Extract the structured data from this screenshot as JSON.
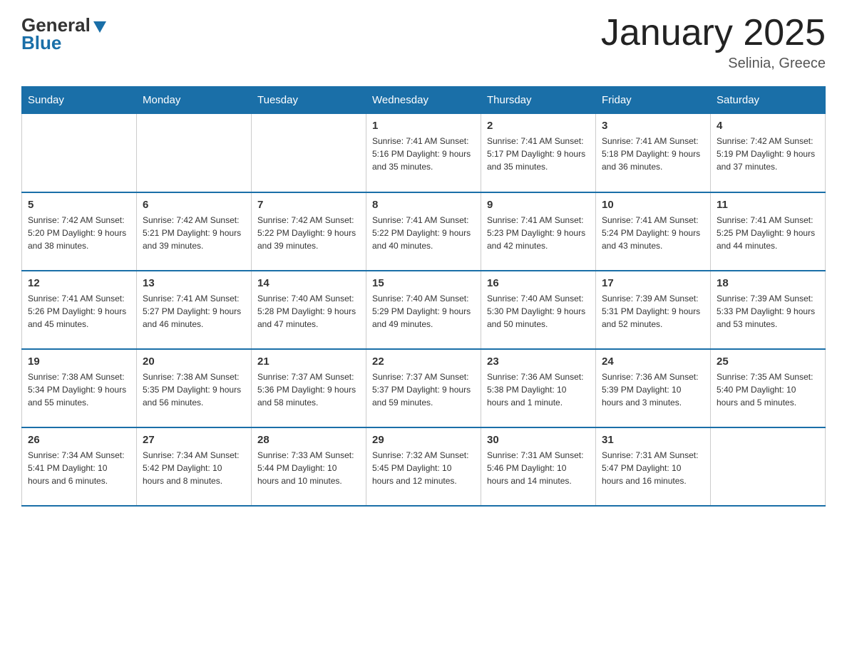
{
  "logo": {
    "general": "General",
    "blue": "Blue"
  },
  "header": {
    "title": "January 2025",
    "location": "Selinia, Greece"
  },
  "weekdays": [
    "Sunday",
    "Monday",
    "Tuesday",
    "Wednesday",
    "Thursday",
    "Friday",
    "Saturday"
  ],
  "weeks": [
    [
      {
        "day": "",
        "info": ""
      },
      {
        "day": "",
        "info": ""
      },
      {
        "day": "",
        "info": ""
      },
      {
        "day": "1",
        "info": "Sunrise: 7:41 AM\nSunset: 5:16 PM\nDaylight: 9 hours\nand 35 minutes."
      },
      {
        "day": "2",
        "info": "Sunrise: 7:41 AM\nSunset: 5:17 PM\nDaylight: 9 hours\nand 35 minutes."
      },
      {
        "day": "3",
        "info": "Sunrise: 7:41 AM\nSunset: 5:18 PM\nDaylight: 9 hours\nand 36 minutes."
      },
      {
        "day": "4",
        "info": "Sunrise: 7:42 AM\nSunset: 5:19 PM\nDaylight: 9 hours\nand 37 minutes."
      }
    ],
    [
      {
        "day": "5",
        "info": "Sunrise: 7:42 AM\nSunset: 5:20 PM\nDaylight: 9 hours\nand 38 minutes."
      },
      {
        "day": "6",
        "info": "Sunrise: 7:42 AM\nSunset: 5:21 PM\nDaylight: 9 hours\nand 39 minutes."
      },
      {
        "day": "7",
        "info": "Sunrise: 7:42 AM\nSunset: 5:22 PM\nDaylight: 9 hours\nand 39 minutes."
      },
      {
        "day": "8",
        "info": "Sunrise: 7:41 AM\nSunset: 5:22 PM\nDaylight: 9 hours\nand 40 minutes."
      },
      {
        "day": "9",
        "info": "Sunrise: 7:41 AM\nSunset: 5:23 PM\nDaylight: 9 hours\nand 42 minutes."
      },
      {
        "day": "10",
        "info": "Sunrise: 7:41 AM\nSunset: 5:24 PM\nDaylight: 9 hours\nand 43 minutes."
      },
      {
        "day": "11",
        "info": "Sunrise: 7:41 AM\nSunset: 5:25 PM\nDaylight: 9 hours\nand 44 minutes."
      }
    ],
    [
      {
        "day": "12",
        "info": "Sunrise: 7:41 AM\nSunset: 5:26 PM\nDaylight: 9 hours\nand 45 minutes."
      },
      {
        "day": "13",
        "info": "Sunrise: 7:41 AM\nSunset: 5:27 PM\nDaylight: 9 hours\nand 46 minutes."
      },
      {
        "day": "14",
        "info": "Sunrise: 7:40 AM\nSunset: 5:28 PM\nDaylight: 9 hours\nand 47 minutes."
      },
      {
        "day": "15",
        "info": "Sunrise: 7:40 AM\nSunset: 5:29 PM\nDaylight: 9 hours\nand 49 minutes."
      },
      {
        "day": "16",
        "info": "Sunrise: 7:40 AM\nSunset: 5:30 PM\nDaylight: 9 hours\nand 50 minutes."
      },
      {
        "day": "17",
        "info": "Sunrise: 7:39 AM\nSunset: 5:31 PM\nDaylight: 9 hours\nand 52 minutes."
      },
      {
        "day": "18",
        "info": "Sunrise: 7:39 AM\nSunset: 5:33 PM\nDaylight: 9 hours\nand 53 minutes."
      }
    ],
    [
      {
        "day": "19",
        "info": "Sunrise: 7:38 AM\nSunset: 5:34 PM\nDaylight: 9 hours\nand 55 minutes."
      },
      {
        "day": "20",
        "info": "Sunrise: 7:38 AM\nSunset: 5:35 PM\nDaylight: 9 hours\nand 56 minutes."
      },
      {
        "day": "21",
        "info": "Sunrise: 7:37 AM\nSunset: 5:36 PM\nDaylight: 9 hours\nand 58 minutes."
      },
      {
        "day": "22",
        "info": "Sunrise: 7:37 AM\nSunset: 5:37 PM\nDaylight: 9 hours\nand 59 minutes."
      },
      {
        "day": "23",
        "info": "Sunrise: 7:36 AM\nSunset: 5:38 PM\nDaylight: 10 hours\nand 1 minute."
      },
      {
        "day": "24",
        "info": "Sunrise: 7:36 AM\nSunset: 5:39 PM\nDaylight: 10 hours\nand 3 minutes."
      },
      {
        "day": "25",
        "info": "Sunrise: 7:35 AM\nSunset: 5:40 PM\nDaylight: 10 hours\nand 5 minutes."
      }
    ],
    [
      {
        "day": "26",
        "info": "Sunrise: 7:34 AM\nSunset: 5:41 PM\nDaylight: 10 hours\nand 6 minutes."
      },
      {
        "day": "27",
        "info": "Sunrise: 7:34 AM\nSunset: 5:42 PM\nDaylight: 10 hours\nand 8 minutes."
      },
      {
        "day": "28",
        "info": "Sunrise: 7:33 AM\nSunset: 5:44 PM\nDaylight: 10 hours\nand 10 minutes."
      },
      {
        "day": "29",
        "info": "Sunrise: 7:32 AM\nSunset: 5:45 PM\nDaylight: 10 hours\nand 12 minutes."
      },
      {
        "day": "30",
        "info": "Sunrise: 7:31 AM\nSunset: 5:46 PM\nDaylight: 10 hours\nand 14 minutes."
      },
      {
        "day": "31",
        "info": "Sunrise: 7:31 AM\nSunset: 5:47 PM\nDaylight: 10 hours\nand 16 minutes."
      },
      {
        "day": "",
        "info": ""
      }
    ]
  ]
}
